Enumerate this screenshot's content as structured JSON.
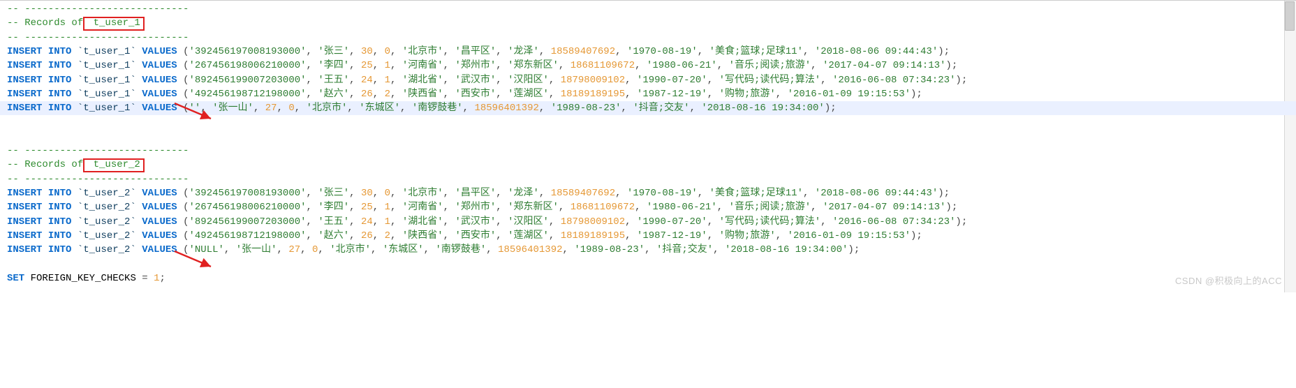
{
  "sections": [
    {
      "dash": "-- ----------------------------",
      "records_of": "-- Records of",
      "table_short": " t_user_1",
      "table": "`t_user_1`"
    },
    {
      "dash": "-- ----------------------------",
      "records_of": "-- Records of",
      "table_short": " t_user_2",
      "table": "`t_user_2`"
    }
  ],
  "kw": {
    "insert": "INSERT",
    "into": "INTO",
    "values": "VALUES",
    "set": "SET"
  },
  "rows1": [
    {
      "id": "'392456197008193000'",
      "name": "'张三'",
      "age": "30",
      "flag": "0",
      "p": "'北京市'",
      "c": "'昌平区'",
      "d": "'龙泽'",
      "phone": "18589407692",
      "birth": "'1970-08-19'",
      "hobby": "'美食;篮球;足球11'",
      "created": "'2018-08-06 09:44:43'",
      "wrap": true
    },
    {
      "id": "'267456198006210000'",
      "name": "'李四'",
      "age": "25",
      "flag": "1",
      "p": "'河南省'",
      "c": "'郑州市'",
      "d": "'郑东新区'",
      "phone": "18681109672",
      "birth": "'1980-06-21'",
      "hobby": "'音乐;阅读;旅游'",
      "created": "'2017-04-07 09:14:13'",
      "wrap": true
    },
    {
      "id": "'892456199007203000'",
      "name": "'王五'",
      "age": "24",
      "flag": "1",
      "p": "'湖北省'",
      "c": "'武汉市'",
      "d": "'汉阳区'",
      "phone": "18798009102",
      "birth": "'1990-07-20'",
      "hobby": "'写代码;读代码;算法'",
      "created": "'2016-06-08 07:34:23'",
      "wrap": true
    },
    {
      "id": "'492456198712198000'",
      "name": "'赵六'",
      "age": "26",
      "flag": "2",
      "p": "'陕西省'",
      "c": "'西安市'",
      "d": "'莲湖区'",
      "phone": "18189189195",
      "birth": "'1987-12-19'",
      "hobby": "'购物;旅游'",
      "created": "'2016-01-09 19:15:53'",
      "wrap": false
    },
    {
      "id": "''",
      "name": "'张一山'",
      "age": "27",
      "flag": "0",
      "p": "'北京市'",
      "c": "'东城区'",
      "d": "'南锣鼓巷'",
      "phone": "18596401392",
      "birth": "'1989-08-23'",
      "hobby": "'抖音;交友'",
      "created": "'2018-08-16 19:34:00'",
      "wrap": false,
      "highlight": true
    }
  ],
  "rows2": [
    {
      "id": "'392456197008193000'",
      "name": "'张三'",
      "age": "30",
      "flag": "0",
      "p": "'北京市'",
      "c": "'昌平区'",
      "d": "'龙泽'",
      "phone": "18589407692",
      "birth": "'1970-08-19'",
      "hobby": "'美食;篮球;足球11'",
      "created": "'2018-08-06 09:44:43'",
      "wrap": true
    },
    {
      "id": "'267456198006210000'",
      "name": "'李四'",
      "age": "25",
      "flag": "1",
      "p": "'河南省'",
      "c": "'郑州市'",
      "d": "'郑东新区'",
      "phone": "18681109672",
      "birth": "'1980-06-21'",
      "hobby": "'音乐;阅读;旅游'",
      "created": "'2017-04-07 09:14:13'",
      "wrap": true
    },
    {
      "id": "'892456199007203000'",
      "name": "'王五'",
      "age": "24",
      "flag": "1",
      "p": "'湖北省'",
      "c": "'武汉市'",
      "d": "'汉阳区'",
      "phone": "18798009102",
      "birth": "'1990-07-20'",
      "hobby": "'写代码;读代码;算法'",
      "created": "'2016-06-08 07:34:23'",
      "wrap": true
    },
    {
      "id": "'492456198712198000'",
      "name": "'赵六'",
      "age": "26",
      "flag": "2",
      "p": "'陕西省'",
      "c": "'西安市'",
      "d": "'莲湖区'",
      "phone": "18189189195",
      "birth": "'1987-12-19'",
      "hobby": "'购物;旅游'",
      "created": "'2016-01-09 19:15:53'",
      "wrap": false
    },
    {
      "id": "'NULL'",
      "name": "'张一山'",
      "age": "27",
      "flag": "0",
      "p": "'北京市'",
      "c": "'东城区'",
      "d": "'南锣鼓巷'",
      "phone": "18596401392",
      "birth": "'1989-08-23'",
      "hobby": "'抖音;交友'",
      "created": "'2018-08-16 19:34:00'",
      "wrap": false
    }
  ],
  "footer": {
    "var": "FOREIGN_KEY_CHECKS",
    "eq": " = ",
    "val": "1",
    "semi": ";"
  },
  "watermark": "CSDN @积极向上的ACC",
  "paren_open": " (",
  "paren_close": ")",
  "comma": ", ",
  "semi": ";"
}
